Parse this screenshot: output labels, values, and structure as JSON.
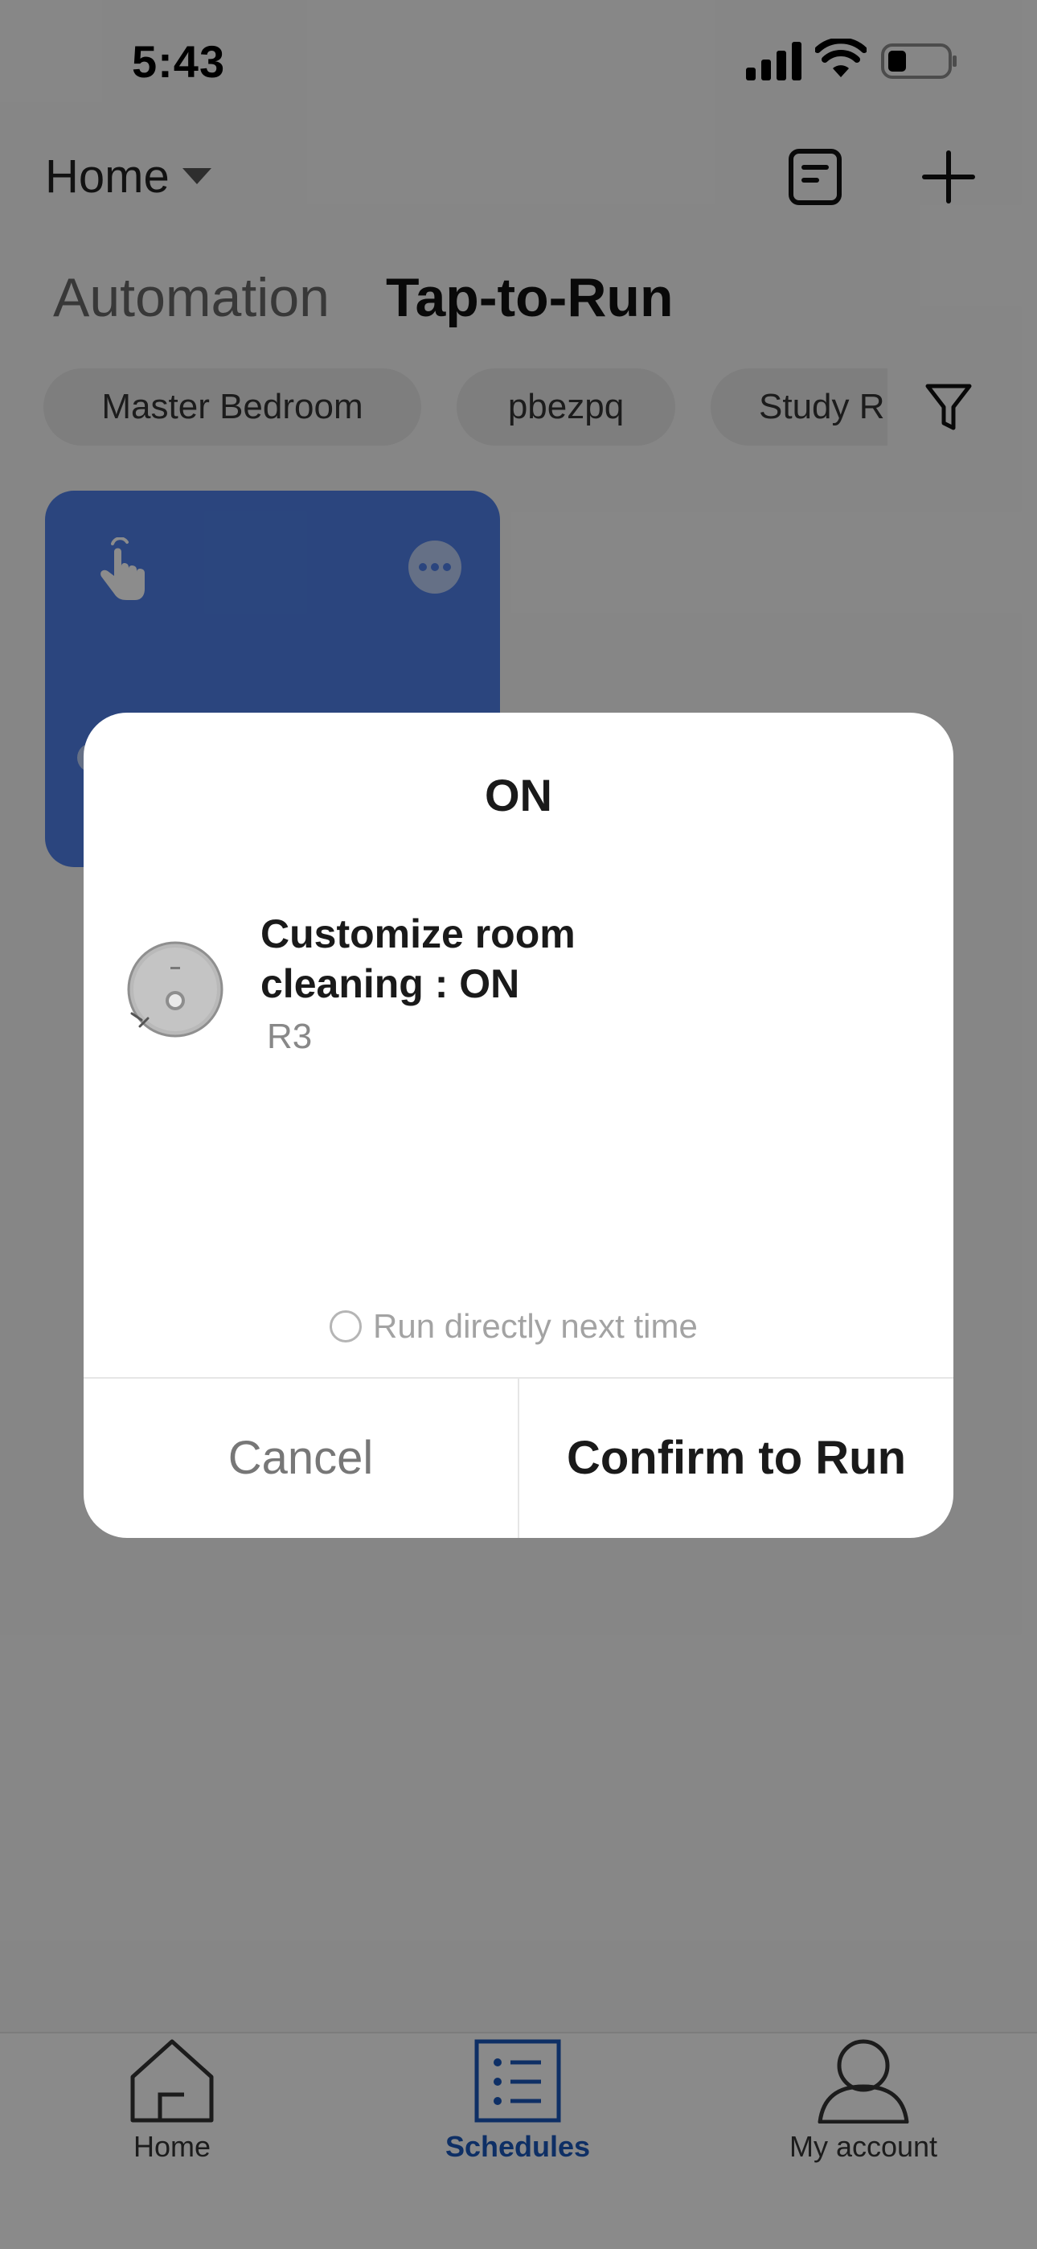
{
  "status_bar": {
    "time": "5:43"
  },
  "header": {
    "home_label": "Home"
  },
  "tabs": {
    "automation": "Automation",
    "tap_to_run": "Tap-to-Run"
  },
  "room_filters": [
    "Master Bedroom",
    "pbezpq",
    "Study R"
  ],
  "dialog": {
    "title": "ON",
    "action_name": "Customize room cleaning : ON",
    "device_name": "R3",
    "run_next_label": "Run directly next time",
    "cancel_label": "Cancel",
    "confirm_label": "Confirm to Run"
  },
  "tab_bar": {
    "home": "Home",
    "schedules": "Schedules",
    "account": "My account"
  },
  "colors": {
    "accent": "#1a56b8",
    "card": "#4f7fe6",
    "overlay": "rgba(0,0,0,0.45)"
  },
  "icons": [
    "signal-icon",
    "wifi-icon",
    "battery-icon",
    "caret-icon",
    "document-icon",
    "plus-icon",
    "filter-icon",
    "tap-hand-icon",
    "more-icon",
    "robot-vacuum-icon",
    "home-tab-icon",
    "schedules-tab-icon",
    "account-tab-icon"
  ]
}
